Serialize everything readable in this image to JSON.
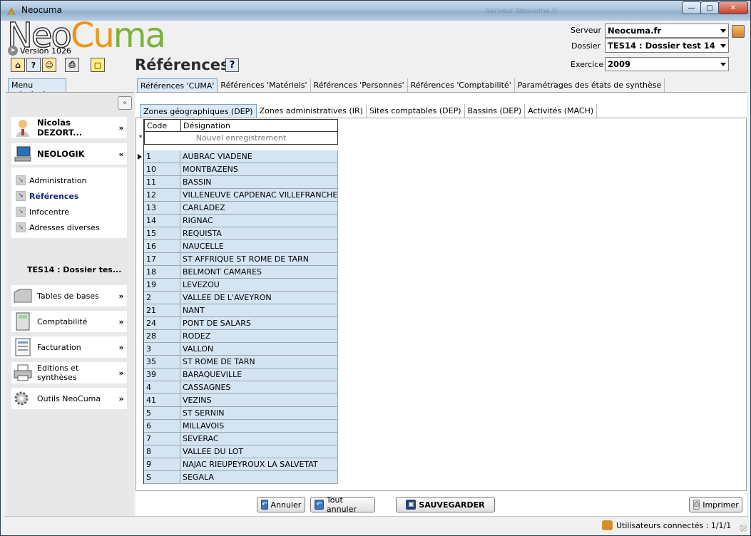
{
  "window": {
    "title": "Neocuma",
    "ghost_text": "Serveur  Neocuma.fr"
  },
  "header": {
    "logo": {
      "neo": "Neo",
      "cu": "Cu",
      "ma": "ma"
    },
    "version": "Version 1026",
    "serveur_label": "Serveur",
    "serveur_value": "Neocuma.fr",
    "dossier_label": "Dossier",
    "dossier_value": "TES14 : Dossier test 14",
    "exercice_label": "Exercice",
    "exercice_value": "2009",
    "page_title": "Références",
    "help_glyph": "?"
  },
  "toolbar": {
    "icons": [
      "home-icon",
      "help-icon",
      "user-search-icon",
      "print-icon",
      "note-icon"
    ]
  },
  "left_panel": {
    "tab": "Menu principal",
    "user": "Nicolas DEZORT...",
    "org": "NEOLOGIK",
    "submenu": [
      "Administration",
      "Références",
      "Infocentre",
      "Adresses diverses"
    ],
    "dossier": "TES14 : Dossier tes...",
    "sections": [
      "Tables de bases",
      "Comptabilité",
      "Facturation",
      "Editions et synthèses",
      "Outils NeoCuma"
    ]
  },
  "tabs": [
    "Références 'CUMA'",
    "Références 'Matériels'",
    "Références 'Personnes'",
    "Références 'Comptabilité'",
    "Paramétrages des états de synthèse"
  ],
  "subtabs": [
    "Zones géographiques (DEP)",
    "Zones administratives (IR)",
    "Sites comptables (DEP)",
    "Bassins (DEP)",
    "Activités (MACH)"
  ],
  "grid": {
    "col_code": "Code",
    "col_designation": "Désignation",
    "new_record": "Nouvel enregistrement",
    "new_marker": "*",
    "rows": [
      [
        "1",
        "AUBRAC VIADENE"
      ],
      [
        "10",
        "MONTBAZENS"
      ],
      [
        "11",
        "BASSIN"
      ],
      [
        "12",
        "VILLENEUVE CAPDENAC VILLEFRANCHE"
      ],
      [
        "13",
        "CARLADEZ"
      ],
      [
        "14",
        "RIGNAC"
      ],
      [
        "15",
        "REQUISTA"
      ],
      [
        "16",
        "NAUCELLE"
      ],
      [
        "17",
        "ST AFFRIQUE ST ROME DE TARN"
      ],
      [
        "18",
        "BELMONT CAMARES"
      ],
      [
        "19",
        "LEVEZOU"
      ],
      [
        "2",
        "VALLEE DE L'AVEYRON"
      ],
      [
        "21",
        "NANT"
      ],
      [
        "24",
        "PONT DE SALARS"
      ],
      [
        "28",
        "RODEZ"
      ],
      [
        "3",
        "VALLON"
      ],
      [
        "35",
        "ST ROME DE TARN"
      ],
      [
        "39",
        "BARAQUEVILLE"
      ],
      [
        "4",
        "CASSAGNES"
      ],
      [
        "41",
        "VEZINS"
      ],
      [
        "5",
        "ST SERNIN"
      ],
      [
        "6",
        "MILLAVOIS"
      ],
      [
        "7",
        "SEVERAC"
      ],
      [
        "8",
        "VALLEE DU LOT"
      ],
      [
        "9",
        "NAJAC RIEUPEYROUX LA SALVETAT"
      ],
      [
        "S",
        "SEGALA"
      ]
    ]
  },
  "buttons": {
    "annuler": "Annuler",
    "tout_annuler": "Tout annuler",
    "sauvegarder": "SAUVEGARDER",
    "imprimer": "Imprimer"
  },
  "status": {
    "users": "Utilisateurs connectés : 1/1/1"
  }
}
